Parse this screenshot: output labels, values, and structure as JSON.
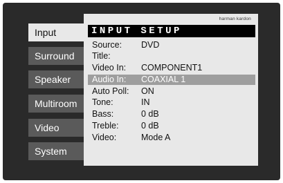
{
  "nav": {
    "tabs": [
      {
        "label": "Input",
        "active": true
      },
      {
        "label": "Surround",
        "active": false
      },
      {
        "label": "Speaker",
        "active": false
      },
      {
        "label": "Multiroom",
        "active": false
      },
      {
        "label": "Video",
        "active": false
      },
      {
        "label": "System",
        "active": false
      }
    ]
  },
  "panel": {
    "brand": "harman kardon",
    "title": "INPUT SETUP",
    "rows": [
      {
        "label": "Source:",
        "value": "DVD"
      },
      {
        "label": "Title:",
        "value": ""
      },
      {
        "label": "Video In:",
        "value": "COMPONENT1"
      },
      {
        "label": "Audio In:",
        "value": "COAXIAL 1",
        "selected": true
      },
      {
        "label": "Auto Poll:",
        "value": "ON"
      },
      {
        "label": "Tone:",
        "value": "IN"
      },
      {
        "label": "Bass:",
        "value": "0 dB"
      },
      {
        "label": "Treble:",
        "value": "0 dB"
      },
      {
        "label": "Video:",
        "value": "Mode A"
      }
    ]
  },
  "colors": {
    "screen_bg": "#2a2a2a",
    "panel_bg": "#e8e8e8",
    "tab_bg": "#5a5a5a",
    "title_bar": "#000000",
    "selected_row": "#9e9e9e"
  }
}
